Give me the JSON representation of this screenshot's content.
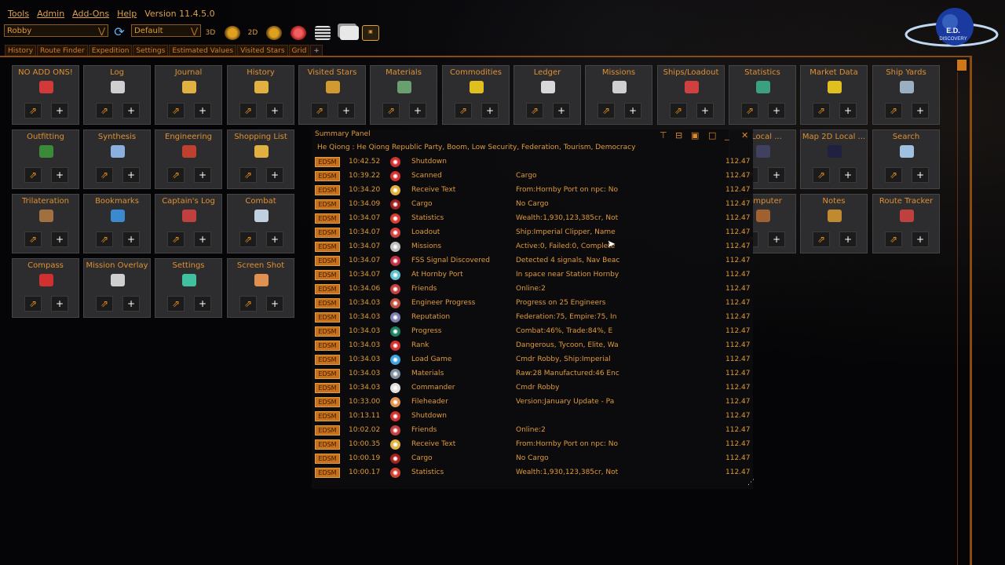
{
  "menu": {
    "items": [
      "Tools",
      "Admin",
      "Add-Ons",
      "Help"
    ],
    "version": "Version 11.4.5.0"
  },
  "toolbar": {
    "commander": "Robby",
    "profile": "Default",
    "btn_3d": "3D",
    "btn_2d": "2D"
  },
  "tabs": [
    "History",
    "Route Finder",
    "Expedition",
    "Settings",
    "Estimated Values",
    "Visited Stars",
    "Grid",
    "+"
  ],
  "logo": {
    "text": "E.D. DISCOVERY"
  },
  "tiles": [
    {
      "label": "NO ADD ONS!",
      "icon": "cluster-icon",
      "color": "#d23a3a"
    },
    {
      "label": "Log",
      "icon": "log-icon",
      "color": "#cfcfcf"
    },
    {
      "label": "Journal",
      "icon": "journal-icon",
      "color": "#e0b040"
    },
    {
      "label": "History",
      "icon": "history-icon",
      "color": "#e0b040"
    },
    {
      "label": "Visited Stars",
      "icon": "visited-stars-icon",
      "color": "#d09a30"
    },
    {
      "label": "Materials",
      "icon": "materials-icon",
      "color": "#6aa070"
    },
    {
      "label": "Commodities",
      "icon": "commodities-icon",
      "color": "#e0c020"
    },
    {
      "label": "Ledger",
      "icon": "ledger-icon",
      "color": "#d8d8d8"
    },
    {
      "label": "Missions",
      "icon": "missions-icon",
      "color": "#cfcfcf"
    },
    {
      "label": "Ships/Loadout",
      "icon": "ships-icon",
      "color": "#d04040"
    },
    {
      "label": "Statistics",
      "icon": "statistics-icon",
      "color": "#3aa080"
    },
    {
      "label": "Market Data",
      "icon": "market-icon",
      "color": "#e0c020"
    },
    {
      "label": "Ship Yards",
      "icon": "shipyard-icon",
      "color": "#9ab0c0"
    },
    {
      "label": "Outfitting",
      "icon": "outfitting-icon",
      "color": "#3a8a3a"
    },
    {
      "label": "Synthesis",
      "icon": "synthesis-icon",
      "color": "#8ab0e0"
    },
    {
      "label": "Engineering",
      "icon": "engineering-icon",
      "color": "#c04030"
    },
    {
      "label": "Shopping List",
      "icon": "shopping-icon",
      "color": "#e0b040"
    },
    {
      "label": "D Local ...",
      "icon": "map-icon",
      "color": "#404060"
    },
    {
      "label": "Map 2D Local ...",
      "icon": "map2d-icon",
      "color": "#202040"
    },
    {
      "label": "Search",
      "icon": "search-icon",
      "color": "#a0c0e0"
    },
    {
      "label": "Trilateration",
      "icon": "trilateration-icon",
      "color": "#a07040"
    },
    {
      "label": "Bookmarks",
      "icon": "bookmarks-icon",
      "color": "#3a8ad0"
    },
    {
      "label": "Captain's Log",
      "icon": "captains-log-icon",
      "color": "#c04040"
    },
    {
      "label": "Combat",
      "icon": "combat-icon",
      "color": "#c0d0e0"
    },
    {
      "label": "Computer",
      "icon": "computer-icon",
      "color": "#a06030"
    },
    {
      "label": "Notes",
      "icon": "notes-icon",
      "color": "#c08a30"
    },
    {
      "label": "Route Tracker",
      "icon": "route-tracker-icon",
      "color": "#c04040"
    },
    {
      "label": "Compass",
      "icon": "compass-icon",
      "color": "#d03030"
    },
    {
      "label": "Mission Overlay",
      "icon": "mission-overlay-icon",
      "color": "#cfcfcf"
    },
    {
      "label": "Settings",
      "icon": "settings-icon",
      "color": "#40c0a0"
    },
    {
      "label": "Screen Shot",
      "icon": "screenshot-icon",
      "color": "#e09050"
    }
  ],
  "panel": {
    "title": "Summary Panel",
    "system": "He Qiong : He Qiong Republic Party, Boom, Low Security, Federation, Tourism, Democracy",
    "badge": "EDSM",
    "rows": [
      {
        "time": "10:42.52",
        "icon": "shutdown-icon",
        "color": "#d03030",
        "name": "Shutdown",
        "detail": "",
        "val": "112.47"
      },
      {
        "time": "10:39.22",
        "icon": "scanned-icon",
        "color": "#d03030",
        "name": "Scanned",
        "detail": "Cargo",
        "val": "112.47"
      },
      {
        "time": "10:34.20",
        "icon": "receive-text-icon",
        "color": "#e0b040",
        "name": "Receive Text",
        "detail": "From:Hornby Port on npc: No",
        "val": "112.47"
      },
      {
        "time": "10:34.09",
        "icon": "cargo-icon",
        "color": "#a02020",
        "name": "Cargo",
        "detail": "No Cargo",
        "val": "112.47"
      },
      {
        "time": "10:34.07",
        "icon": "statistics-icon",
        "color": "#d04030",
        "name": "Statistics",
        "detail": "Wealth:1,930,123,385cr, Not",
        "val": "112.47"
      },
      {
        "time": "10:34.07",
        "icon": "loadout-icon",
        "color": "#d04040",
        "name": "Loadout",
        "detail": "Ship:Imperial Clipper, Name",
        "val": "112.47"
      },
      {
        "time": "10:34.07",
        "icon": "missions-icon",
        "color": "#c0c0c0",
        "name": "Missions",
        "detail": "Active:0, Failed:0, Complete",
        "val": "112.47"
      },
      {
        "time": "10:34.07",
        "icon": "fss-icon",
        "color": "#c03040",
        "name": "FSS Signal Discovered",
        "detail": "Detected 4 signals, Nav Beac",
        "val": "112.47"
      },
      {
        "time": "10:34.07",
        "icon": "location-icon",
        "color": "#60c0d0",
        "name": "At Hornby Port",
        "detail": "In space near Station Hornby",
        "val": "112.47"
      },
      {
        "time": "10:34.06",
        "icon": "friends-icon",
        "color": "#c04040",
        "name": "Friends",
        "detail": "Online:2",
        "val": "112.47"
      },
      {
        "time": "10:34.03",
        "icon": "engineer-progress-icon",
        "color": "#c05040",
        "name": "Engineer Progress",
        "detail": "Progress on 25 Engineers",
        "val": "112.47"
      },
      {
        "time": "10:34.03",
        "icon": "reputation-icon",
        "color": "#8080b0",
        "name": "Reputation",
        "detail": "Federation:75, Empire:75, In",
        "val": "112.47"
      },
      {
        "time": "10:34.03",
        "icon": "progress-icon",
        "color": "#208060",
        "name": "Progress",
        "detail": "Combat:46%, Trade:84%, E",
        "val": "112.47"
      },
      {
        "time": "10:34.03",
        "icon": "rank-icon",
        "color": "#d03030",
        "name": "Rank",
        "detail": "Dangerous, Tycoon, Elite, Wa",
        "val": "112.47"
      },
      {
        "time": "10:34.03",
        "icon": "load-game-icon",
        "color": "#40a0e0",
        "name": "Load Game",
        "detail": "Cmdr  Robby, Ship:Imperial",
        "val": "112.47"
      },
      {
        "time": "10:34.03",
        "icon": "materials-icon",
        "color": "#8090a0",
        "name": "Materials",
        "detail": "Raw:28 Manufactured:46 Enc",
        "val": "112.47"
      },
      {
        "time": "10:34.03",
        "icon": "commander-icon",
        "color": "#e0e0e0",
        "name": "Commander",
        "detail": "Cmdr Robby",
        "val": "112.47"
      },
      {
        "time": "10:33.00",
        "icon": "fileheader-icon",
        "color": "#e09050",
        "name": "Fileheader",
        "detail": "Version:January Update - Pa",
        "val": "112.47"
      },
      {
        "time": "10:13.11",
        "icon": "shutdown-icon",
        "color": "#d03030",
        "name": "Shutdown",
        "detail": "",
        "val": "112.47"
      },
      {
        "time": "10:02.02",
        "icon": "friends-icon",
        "color": "#c04040",
        "name": "Friends",
        "detail": "Online:2",
        "val": "112.47"
      },
      {
        "time": "10:00.35",
        "icon": "receive-text-icon",
        "color": "#e0b040",
        "name": "Receive Text",
        "detail": "From:Hornby Port on npc: No",
        "val": "112.47"
      },
      {
        "time": "10:00.19",
        "icon": "cargo-icon",
        "color": "#a02020",
        "name": "Cargo",
        "detail": "No Cargo",
        "val": "112.47"
      },
      {
        "time": "10:00.17",
        "icon": "statistics-icon",
        "color": "#d04030",
        "name": "Statistics",
        "detail": "Wealth:1,930,123,385cr, Not",
        "val": "112.47"
      }
    ]
  }
}
